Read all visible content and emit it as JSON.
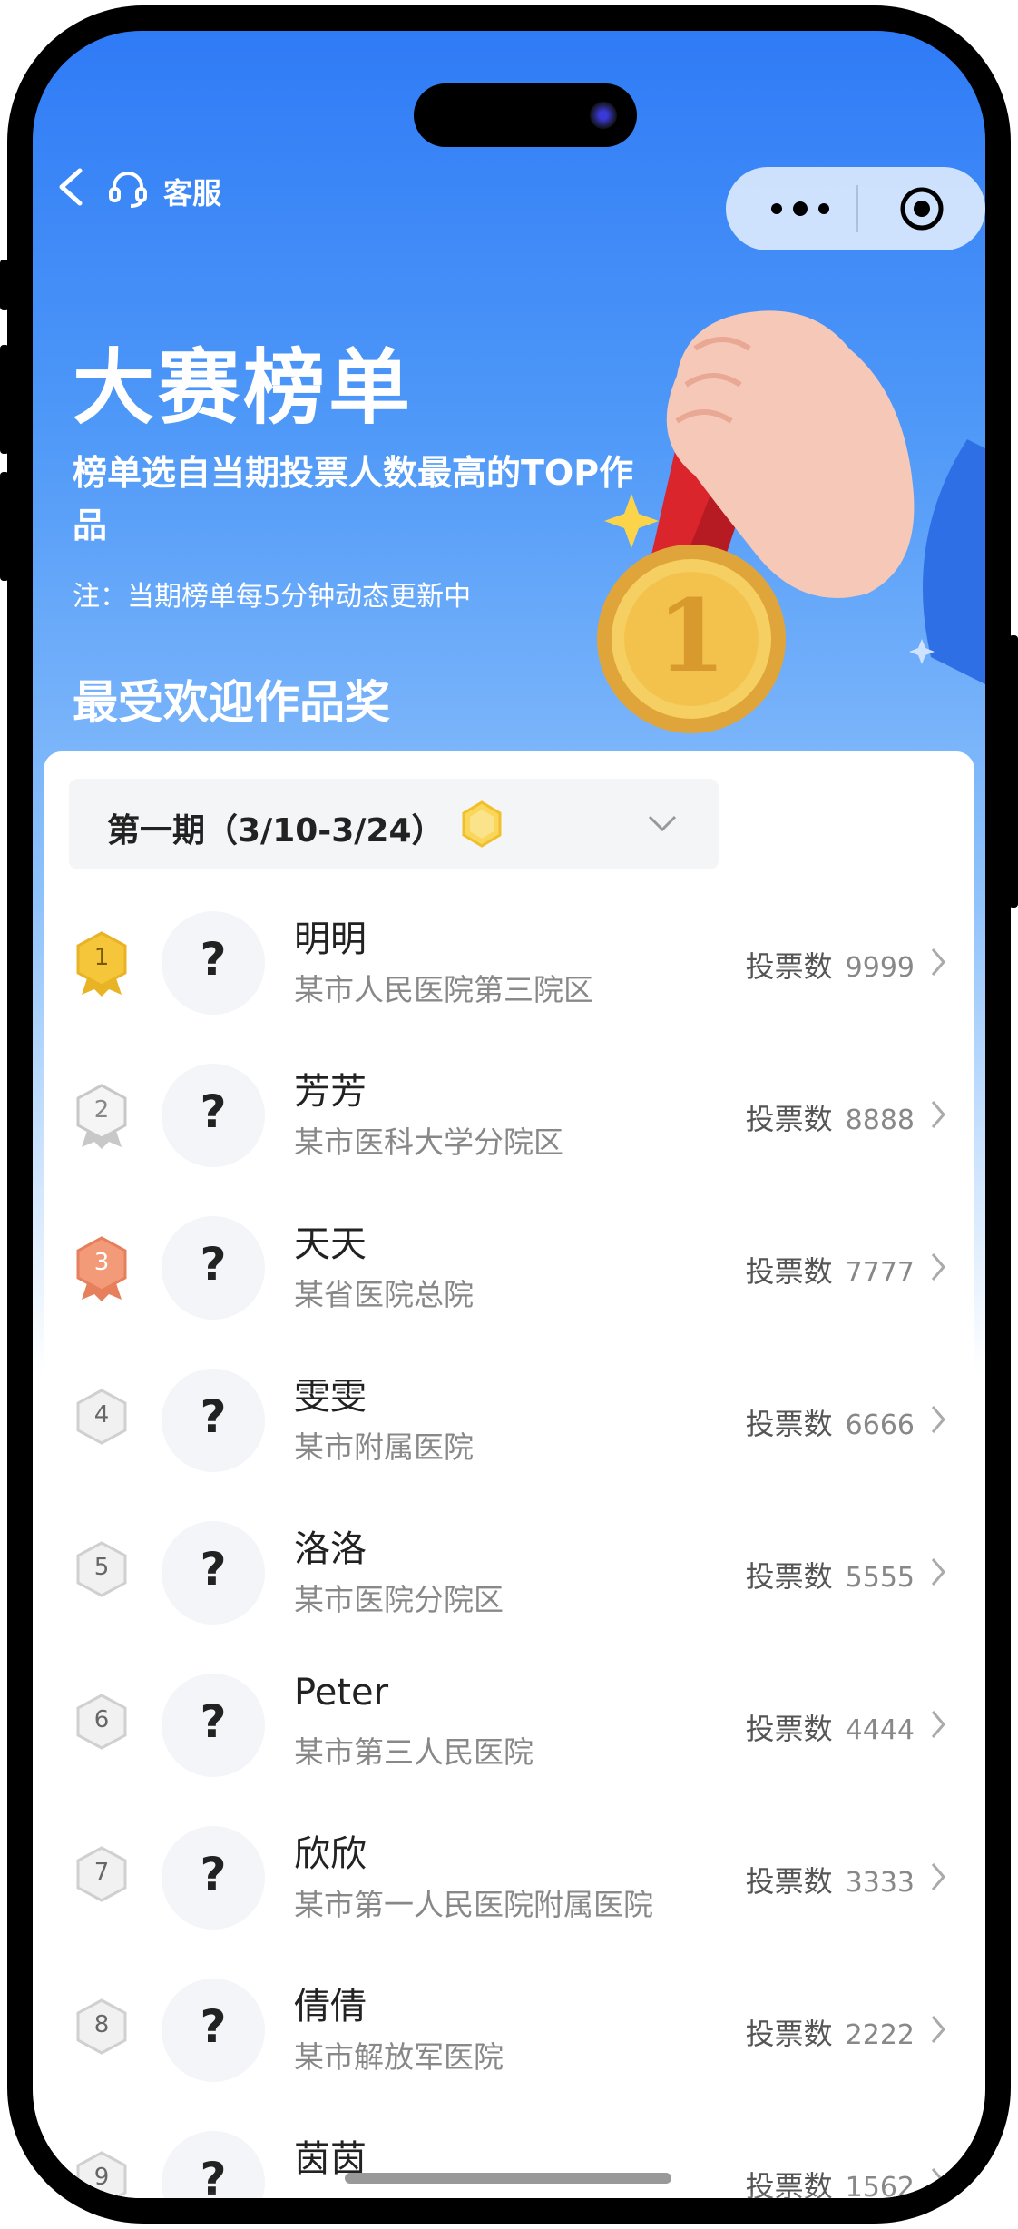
{
  "header": {
    "service_label": "客服",
    "hero_title": "大赛榜单",
    "hero_subtitle": "榜单选自当期投票人数最高的TOP作品",
    "hero_note": "注：当期榜单每5分钟动态更新中",
    "section_title": "最受欢迎作品奖"
  },
  "period": {
    "label": "第一期（3/10-3/24）"
  },
  "vote_label": "投票数",
  "avatar_placeholder": "?",
  "ranking": [
    {
      "rank": "1",
      "name": "明明",
      "org": "某市人民医院第三院区",
      "votes": "9999"
    },
    {
      "rank": "2",
      "name": "芳芳",
      "org": "某市医科大学分院区",
      "votes": "8888"
    },
    {
      "rank": "3",
      "name": "天天",
      "org": "某省医院总院",
      "votes": "7777"
    },
    {
      "rank": "4",
      "name": "雯雯",
      "org": "某市附属医院",
      "votes": "6666"
    },
    {
      "rank": "5",
      "name": "洛洛",
      "org": "某市医院分院区",
      "votes": "5555"
    },
    {
      "rank": "6",
      "name": "Peter",
      "org": "某市第三人民医院",
      "votes": "4444"
    },
    {
      "rank": "7",
      "name": "欣欣",
      "org": "某市第一人民医院附属医院",
      "votes": "3333"
    },
    {
      "rank": "8",
      "name": "倩倩",
      "org": "某市解放军医院",
      "votes": "2222"
    },
    {
      "rank": "9",
      "name": "茵茵",
      "org": "",
      "votes": "1562"
    }
  ],
  "colors": {
    "brand_blue": "#2f7bf6",
    "gold": "#f5c53a",
    "silver": "#c8c8c8",
    "bronze": "#f39a78"
  }
}
